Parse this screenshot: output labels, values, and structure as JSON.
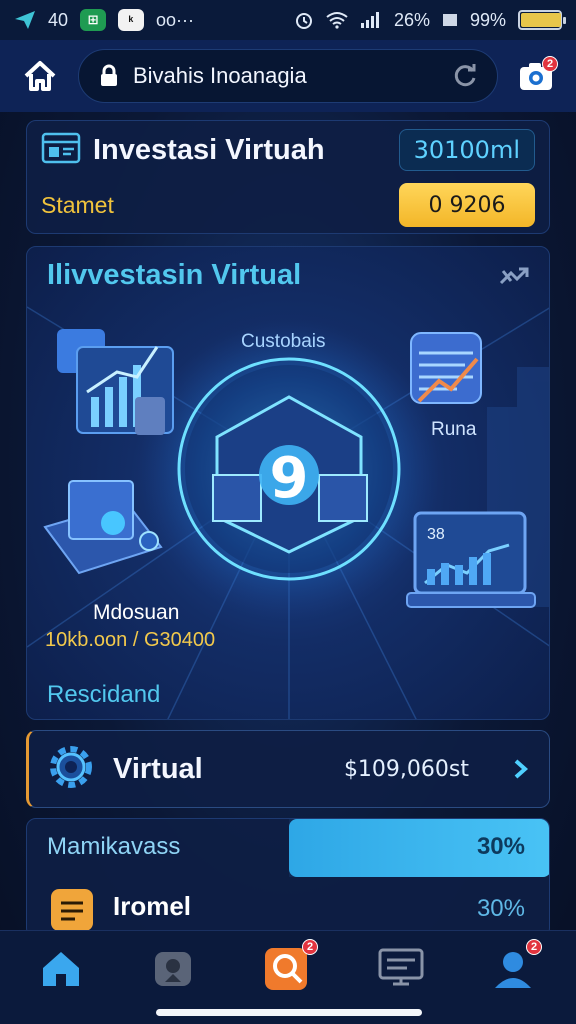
{
  "status_bar": {
    "signal_text": "40",
    "app_chip_1": "⊞",
    "app_chip_2": "ᵏ",
    "dots": "oo···",
    "battery_a": "26%",
    "battery_b": "99%",
    "battery_level": 0.99,
    "icons": [
      "send-icon",
      "alarm-icon",
      "wifi-icon",
      "cell-signal-icon",
      "battery-icon"
    ]
  },
  "header": {
    "url_value": "Bivahis Inoanagia",
    "camera_badge": "2",
    "icons": [
      "home-icon",
      "lock-icon",
      "reload-icon",
      "camera-icon"
    ]
  },
  "balance_card": {
    "title": "Investasi Virtuah",
    "value": "30100ml",
    "label": "Stamet",
    "button_label": "0 9206"
  },
  "hero": {
    "title": "Ilivvestasin Virtual",
    "custobais": "Custobais",
    "runa": "Runa",
    "mdosuan": "Mdosuan",
    "amount": "10kb.oon / G30400",
    "rescidand": "Rescidand",
    "center_label": "9",
    "icons": [
      "shuffle-icon",
      "chart-widget-icon",
      "growth-chart-icon",
      "laptop-icon",
      "monitor-chart-icon",
      "globe-icon"
    ]
  },
  "virtual_row": {
    "title": "Virtual",
    "amount": "$109,060st",
    "icons": [
      "gear-icon",
      "chevron-right-icon"
    ]
  },
  "progress": {
    "row1_label": "Mamikavass",
    "row1_pct": "30%",
    "row1_value": 0.5,
    "row2_label": "Iromel",
    "row2_pct": "30%"
  },
  "nav": {
    "search_badge": "2",
    "profile_badge": "2",
    "items": [
      "home-icon",
      "tag-icon",
      "search-icon",
      "monitor-icon",
      "profile-icon"
    ]
  },
  "colors": {
    "accent": "#52c8ee",
    "yellow": "#f3b628",
    "background": "#0b1836",
    "badge": "#e2343f"
  }
}
